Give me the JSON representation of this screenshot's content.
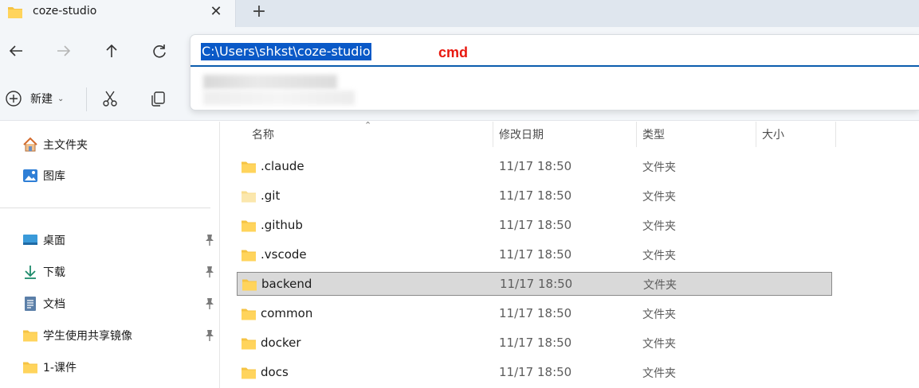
{
  "tab": {
    "title": "coze-studio",
    "close": "✕",
    "new": "+"
  },
  "address": {
    "path": "C:\\Users\\shkst\\coze-studio",
    "annotation": "cmd"
  },
  "toolbar": {
    "new_label": "新建",
    "new_chevron": "⌄"
  },
  "sidebar": {
    "items": [
      {
        "label": "主文件夹",
        "icon": "home-icon"
      },
      {
        "label": "图库",
        "icon": "gallery-icon"
      },
      {
        "label": "桌面",
        "icon": "desktop-icon",
        "pinned": true
      },
      {
        "label": "下载",
        "icon": "download-icon",
        "pinned": true
      },
      {
        "label": "文档",
        "icon": "document-icon",
        "pinned": true
      },
      {
        "label": "学生使用共享镜像",
        "icon": "folder-icon",
        "pinned": true
      },
      {
        "label": "1-课件",
        "icon": "folder-icon"
      }
    ]
  },
  "columns": {
    "name": "名称",
    "date": "修改日期",
    "type": "类型",
    "size": "大小",
    "sort": "⌃"
  },
  "files": [
    {
      "name": ".claude",
      "date": "11/17 18:50",
      "type": "文件夹"
    },
    {
      "name": ".git",
      "date": "11/17 18:50",
      "type": "文件夹"
    },
    {
      "name": ".github",
      "date": "11/17 18:50",
      "type": "文件夹"
    },
    {
      "name": ".vscode",
      "date": "11/17 18:50",
      "type": "文件夹"
    },
    {
      "name": "backend",
      "date": "11/17 18:50",
      "type": "文件夹",
      "selected": true
    },
    {
      "name": "common",
      "date": "11/17 18:50",
      "type": "文件夹"
    },
    {
      "name": "docker",
      "date": "11/17 18:50",
      "type": "文件夹"
    },
    {
      "name": "docs",
      "date": "11/17 18:50",
      "type": "文件夹"
    }
  ],
  "colors": {
    "accent": "#0a59c7",
    "annotation": "#e8180f",
    "folder": "#f5c343",
    "selection": "#d9d9d9"
  }
}
